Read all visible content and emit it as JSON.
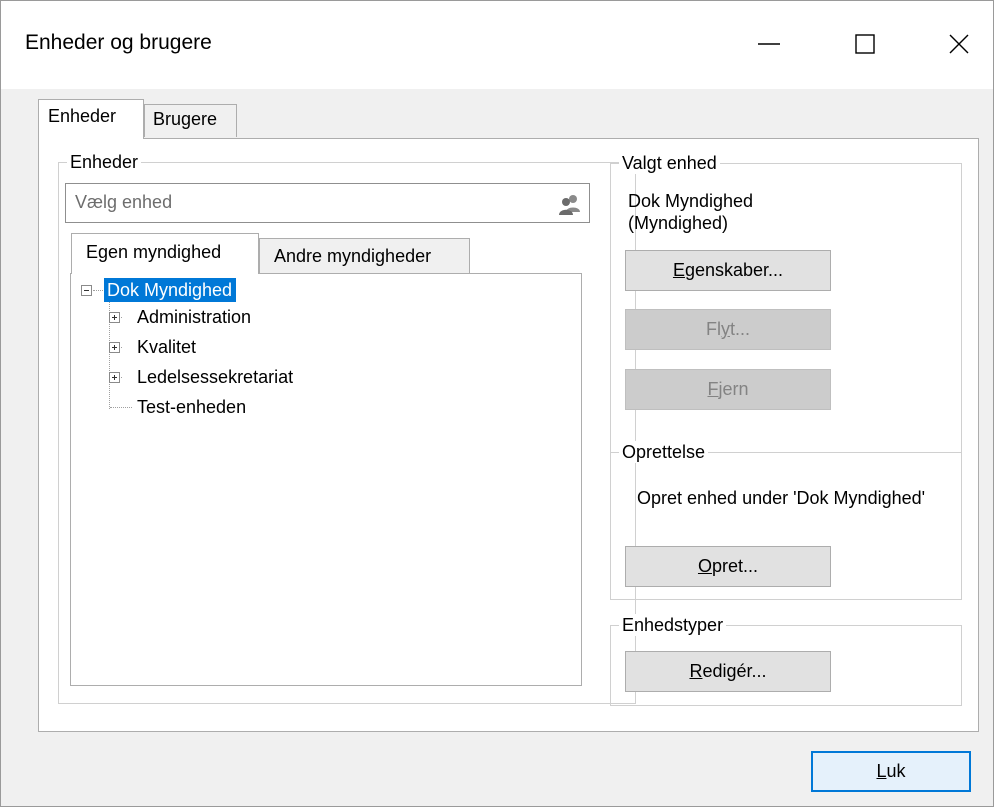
{
  "window": {
    "title": "Enheder og brugere"
  },
  "outer_tabs": [
    {
      "label": "Enheder",
      "active": true
    },
    {
      "label": "Brugere",
      "active": false
    }
  ],
  "enheder_group": {
    "label": "Enheder",
    "search": {
      "placeholder": "Vælg enhed",
      "icon": "users-icon"
    },
    "inner_tabs": [
      {
        "label": "Egen myndighed",
        "active": true
      },
      {
        "label": "Andre myndigheder",
        "active": false
      }
    ],
    "tree": {
      "root": {
        "label": "Dok Myndighed",
        "selected": true,
        "expanded": true
      },
      "children": [
        {
          "label": "Administration",
          "expandable": true
        },
        {
          "label": "Kvalitet",
          "expandable": true
        },
        {
          "label": "Ledelsessekretariat",
          "expandable": true
        },
        {
          "label": "Test-enheden",
          "expandable": false
        }
      ]
    }
  },
  "valgt_group": {
    "label": "Valgt enhed",
    "name_line1": "Dok Myndighed",
    "name_line2": "(Myndighed)",
    "buttons": {
      "egenskaber": {
        "mnemonic": "E",
        "rest": "genskaber..."
      },
      "flyt": {
        "pre": "Fl",
        "mnemonic": "y",
        "rest": "t..."
      },
      "fjern": {
        "mnemonic": "F",
        "rest": "jern"
      }
    }
  },
  "opret_group": {
    "label": "Oprettelse",
    "text": "Opret enhed under 'Dok Myndighed'",
    "button": {
      "mnemonic": "O",
      "rest": "pret..."
    }
  },
  "typer_group": {
    "label": "Enhedstyper",
    "button": {
      "mnemonic": "R",
      "rest": "edigér..."
    }
  },
  "close_button": {
    "mnemonic": "L",
    "rest": "uk"
  },
  "colors": {
    "selection": "#0078d7",
    "window_bg": "#f0f0f0",
    "disabled_button": "#cccccc"
  }
}
